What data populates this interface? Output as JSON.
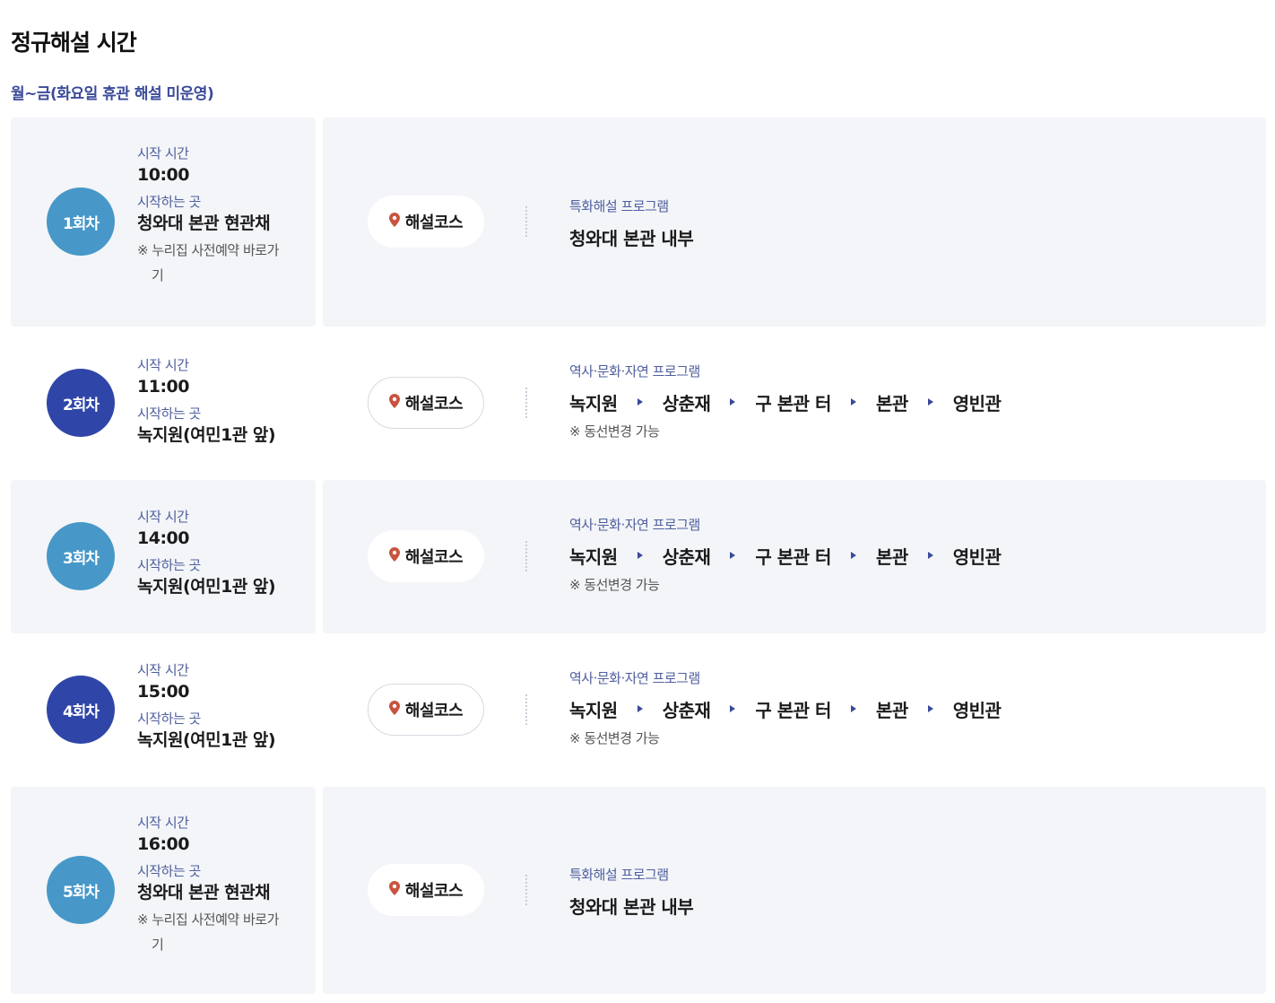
{
  "page_title": "정규해설 시간",
  "schedule_note": "월~금(화요일 휴관 해설 미운영)",
  "labels": {
    "start_time": "시작 시간",
    "start_place": "시작하는 곳",
    "course_button": "해설코스",
    "route_change_note": "※ 동선변경 가능"
  },
  "colors": {
    "badge_light": "#4798c8",
    "badge_dark": "#2f46a8",
    "label_text": "#4f5f9e",
    "pin": "#c9533f"
  },
  "sessions": [
    {
      "badge": "1회차",
      "time": "10:00",
      "place": "청와대 본관 현관채",
      "reservation_note": "※ 누리집 사전예약 바로가기",
      "program_label": "특화해설 프로그램",
      "program_value": "청와대 본관 내부"
    },
    {
      "badge": "2회차",
      "time": "11:00",
      "place": "녹지원(여민1관 앞)",
      "program_label": "역사·문화·자연 프로그램",
      "route": [
        "녹지원",
        "상춘재",
        "구 본관 터",
        "본관",
        "영빈관"
      ]
    },
    {
      "badge": "3회차",
      "time": "14:00",
      "place": "녹지원(여민1관 앞)",
      "program_label": "역사·문화·자연 프로그램",
      "route": [
        "녹지원",
        "상춘재",
        "구 본관 터",
        "본관",
        "영빈관"
      ]
    },
    {
      "badge": "4회차",
      "time": "15:00",
      "place": "녹지원(여민1관 앞)",
      "program_label": "역사·문화·자연 프로그램",
      "route": [
        "녹지원",
        "상춘재",
        "구 본관 터",
        "본관",
        "영빈관"
      ]
    },
    {
      "badge": "5회차",
      "time": "16:00",
      "place": "청와대 본관 현관채",
      "reservation_note": "※ 누리집 사전예약 바로가기",
      "program_label": "특화해설 프로그램",
      "program_value": "청와대 본관 내부"
    }
  ]
}
